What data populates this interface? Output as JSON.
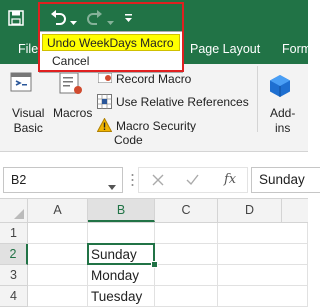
{
  "qat": {
    "save_icon": "save-icon",
    "undo_icon": "undo-icon",
    "redo_icon": "redo-icon",
    "customize_icon": "customize-qat-icon"
  },
  "undo_menu": {
    "items": [
      {
        "label": "Undo WeekDays Macro",
        "highlighted": true
      },
      {
        "label": "Cancel",
        "highlighted": false
      }
    ]
  },
  "tabs": [
    "File",
    "Page Layout",
    "Form"
  ],
  "ribbon": {
    "visual_basic": [
      "Visual",
      "Basic"
    ],
    "macros": "Macros",
    "record_macro": "Record Macro",
    "relative_refs": "Use Relative References",
    "macro_security": "Macro Security",
    "group_label": "Code",
    "addins": [
      "Add-",
      "ins"
    ]
  },
  "formula_bar": {
    "name_box": "B2",
    "fx": "fx",
    "value": "Sunday"
  },
  "grid": {
    "columns": [
      "A",
      "B",
      "C",
      "D"
    ],
    "rows": [
      "1",
      "2",
      "3",
      "4"
    ],
    "cells": {
      "B2": "Sunday",
      "B3": "Monday",
      "B4": "Tuesday"
    },
    "selected": "B2"
  },
  "colors": {
    "excel_green": "#217346",
    "highlight_yellow": "#ffff00",
    "annotation_red": "#e02020"
  }
}
